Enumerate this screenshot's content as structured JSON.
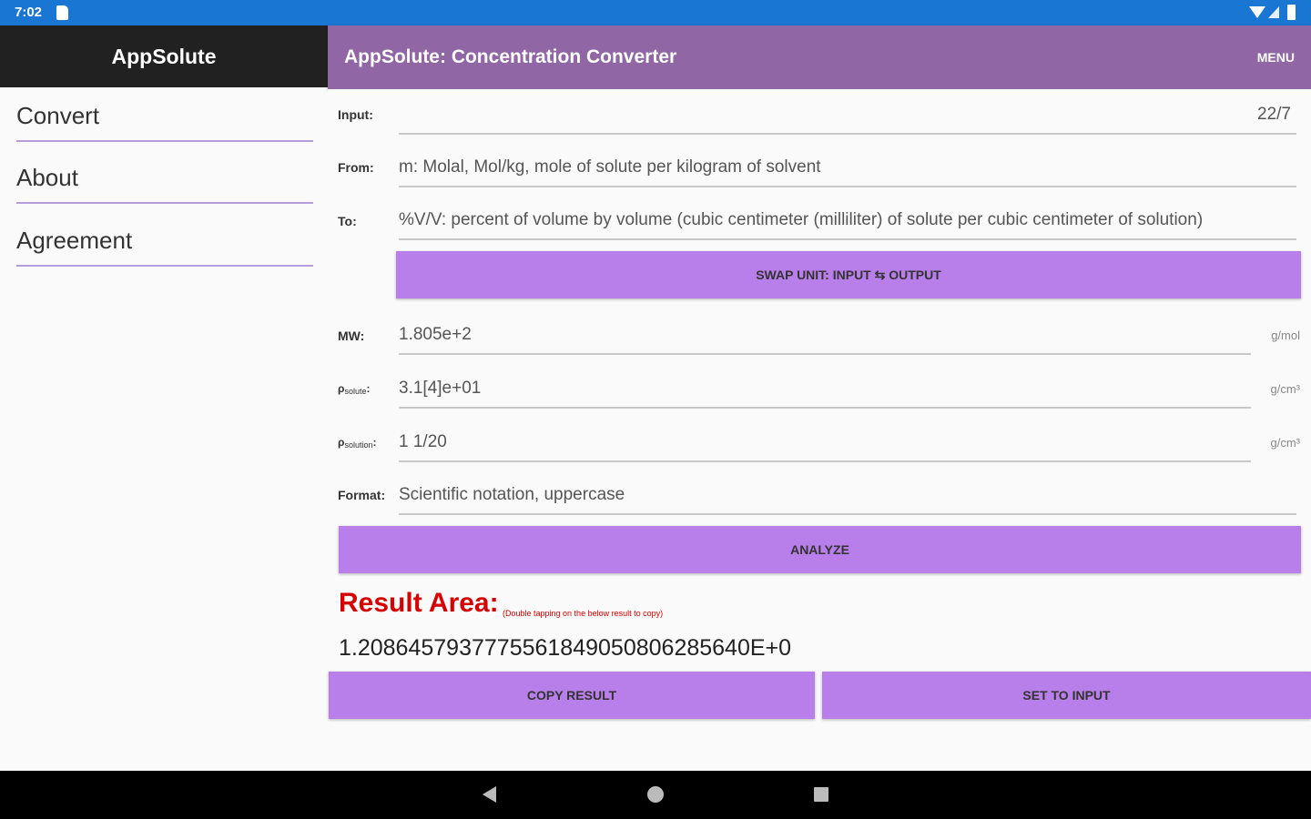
{
  "status_bar": {
    "time": "7:02"
  },
  "drawer": {
    "title": "AppSolute",
    "items": [
      {
        "label": "Convert"
      },
      {
        "label": "About"
      },
      {
        "label": "Agreement"
      }
    ]
  },
  "appbar": {
    "title": "AppSolute: Concentration Converter",
    "menu_label": "MENU"
  },
  "form": {
    "input": {
      "label": "Input:",
      "value": "22/7"
    },
    "from": {
      "label": "From:",
      "value": "m: Molal, Mol/kg, mole of solute per kilogram of solvent"
    },
    "to": {
      "label": "To:",
      "value": "%V/V: percent of volume by volume (cubic centimeter (milliliter) of solute per cubic centimeter of solution)"
    },
    "swap_button": "SWAP UNIT: INPUT ⇆ OUTPUT",
    "mw": {
      "label": "MW:",
      "value": "1.805e+2",
      "unit": "g/mol"
    },
    "rho_solute": {
      "label_main": "ρ",
      "label_sub": "solute",
      "label_suffix": ":",
      "value": "3.1[4]e+01",
      "unit": "g/cm³"
    },
    "rho_solution": {
      "label_main": "ρ",
      "label_sub": "solution",
      "label_suffix": ":",
      "value": "1 1/20",
      "unit": "g/cm³"
    },
    "format": {
      "label": "Format:",
      "value": "Scientific notation, uppercase"
    },
    "analyze_button": "ANALYZE"
  },
  "result": {
    "title": "Result Area:",
    "hint": "(Double tapping on the below result to copy)",
    "value": "1.2086457937775561849050806285640E+0",
    "copy_button": "COPY RESULT",
    "set_button": "SET TO INPUT"
  },
  "colors": {
    "status_bar": "#1976d2",
    "appbar": "#9066a5",
    "drawer_header": "#212121",
    "button": "#b87eea",
    "result_title": "#d50000"
  }
}
